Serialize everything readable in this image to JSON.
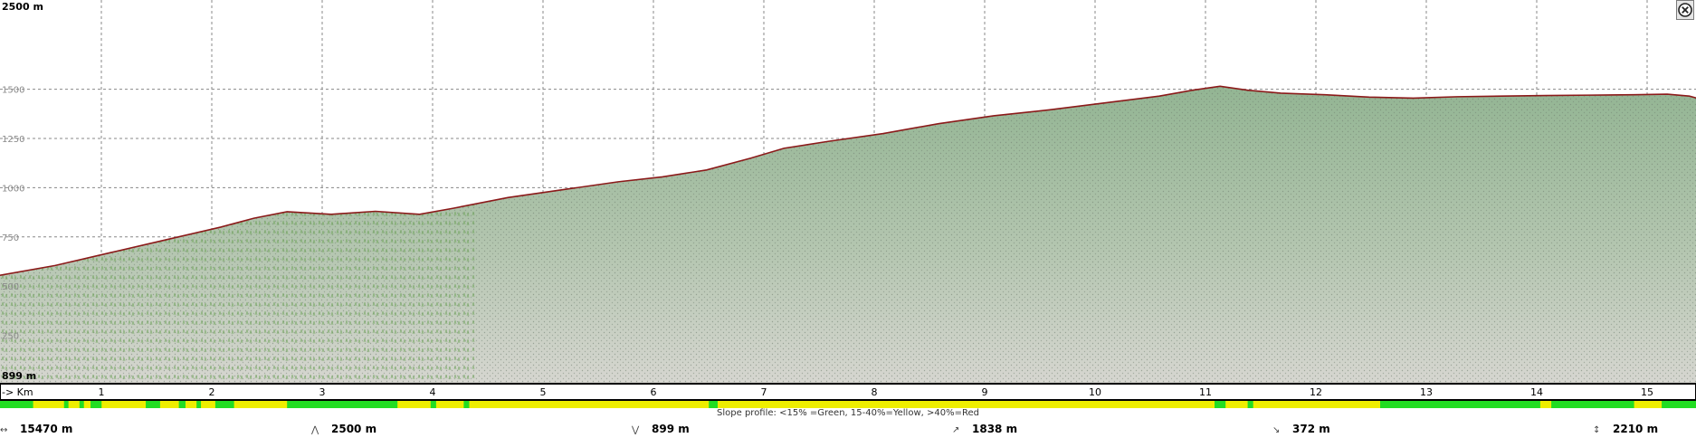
{
  "axis": {
    "y_top_label": "2500 m",
    "y_bottom_label": "899 m",
    "x_unit_label": "-> Km"
  },
  "chart_data": {
    "type": "area",
    "title": "",
    "xlabel": "Km",
    "ylabel": "m",
    "xlim": [
      0,
      15.47
    ],
    "ylim": [
      0,
      1600
    ],
    "y_ticks": [
      "250",
      "500",
      "750",
      "1000",
      "1250",
      "1500"
    ],
    "x_ticks": [
      "1",
      "2",
      "3",
      "4",
      "5",
      "6",
      "7",
      "8",
      "9",
      "10",
      "11",
      "12",
      "13",
      "14",
      "15"
    ],
    "series": [
      {
        "x": [
          0,
          0.5,
          1,
          1.5,
          2,
          2.3,
          2.6,
          3,
          3.4,
          3.8,
          4.1,
          4.6,
          5.1,
          5.6,
          6,
          6.4,
          6.8,
          7.1,
          7.5,
          8,
          8.5,
          9,
          9.5,
          10,
          10.5,
          10.8,
          11.05,
          11.3,
          11.6,
          12,
          12.4,
          12.8,
          13.2,
          13.6,
          14,
          14.4,
          14.8,
          15.1,
          15.3,
          15.47
        ],
        "y": [
          555,
          605,
          670,
          735,
          800,
          845,
          878,
          865,
          880,
          865,
          895,
          950,
          990,
          1030,
          1055,
          1090,
          1150,
          1200,
          1235,
          1275,
          1325,
          1365,
          1395,
          1430,
          1465,
          1495,
          1515,
          1495,
          1480,
          1472,
          1460,
          1455,
          1462,
          1465,
          1468,
          1470,
          1472,
          1475,
          1465,
          1440
        ]
      }
    ]
  },
  "slope_profile": {
    "legend": "Slope profile: <15% =Green, 15-40%=Yellow, >40%=Red",
    "colors": {
      "green": "#22dd22",
      "yellow": "#eeee00",
      "red": "#ee2222"
    },
    "green_segments": [
      [
        0.0,
        0.3
      ],
      [
        0.58,
        0.62
      ],
      [
        0.72,
        0.76
      ],
      [
        0.82,
        0.92
      ],
      [
        1.32,
        1.45
      ],
      [
        1.62,
        1.68
      ],
      [
        1.78,
        1.82
      ],
      [
        1.95,
        2.12
      ],
      [
        2.6,
        3.6
      ],
      [
        3.9,
        3.95
      ],
      [
        4.2,
        4.25
      ],
      [
        6.42,
        6.5
      ],
      [
        11.0,
        11.1
      ],
      [
        11.3,
        11.35
      ],
      [
        12.5,
        13.95
      ],
      [
        14.05,
        14.8
      ],
      [
        15.05,
        15.47
      ]
    ]
  },
  "stats": [
    {
      "icon": "distance-icon",
      "value": "15470 m"
    },
    {
      "icon": "max-elevation-icon",
      "value": "2500 m"
    },
    {
      "icon": "min-elevation-icon",
      "value": "899 m"
    },
    {
      "icon": "total-ascent-icon",
      "value": "1838 m"
    },
    {
      "icon": "total-descent-icon",
      "value": "372 m"
    },
    {
      "icon": "elevation-range-icon",
      "value": "2210 m"
    }
  ],
  "colors": {
    "terrain_fill": "#9fb89f",
    "profile_line": "#8b1a1a",
    "grid": "#888888"
  }
}
